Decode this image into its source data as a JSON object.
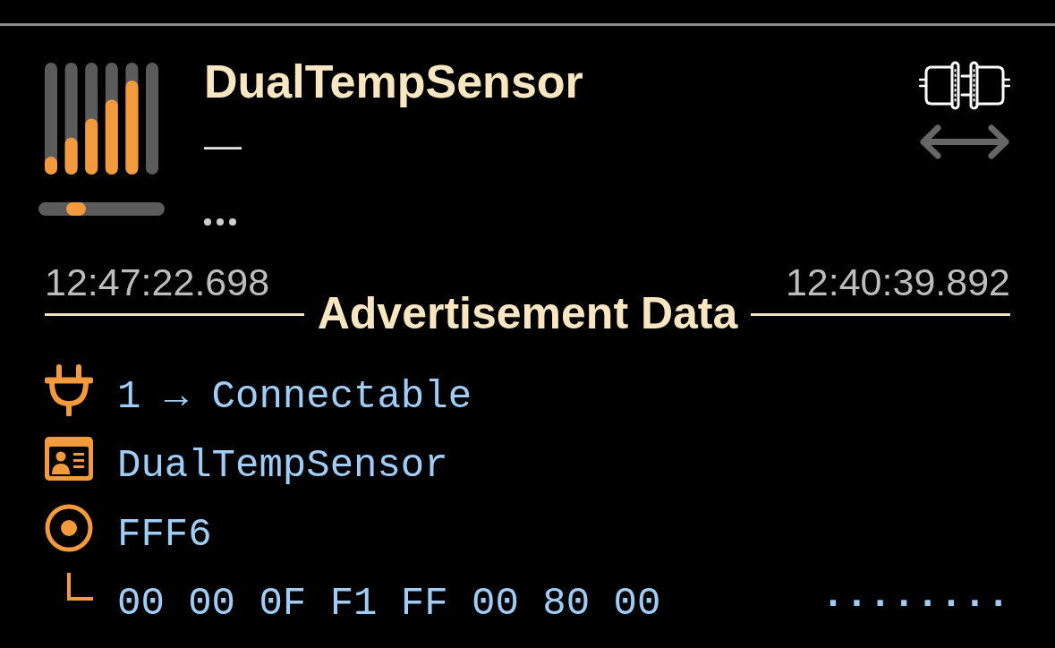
{
  "device": {
    "name": "DualTempSensor",
    "subtitle": "—",
    "slider": {
      "level": 0.3
    }
  },
  "timestamps": [
    "12:47:22.698",
    "12:40:39.892"
  ],
  "section": {
    "title": "Advertisement Data"
  },
  "fields": [
    {
      "kind": "connectable",
      "text": "1 → Connectable"
    },
    {
      "kind": "local_name",
      "text": "DualTempSensor"
    },
    {
      "kind": "service_uuid",
      "text": "FFF6"
    },
    {
      "kind": "service_data",
      "text": "00 00 0F F1 FF 00 80 00",
      "ascii": "········"
    }
  ]
}
